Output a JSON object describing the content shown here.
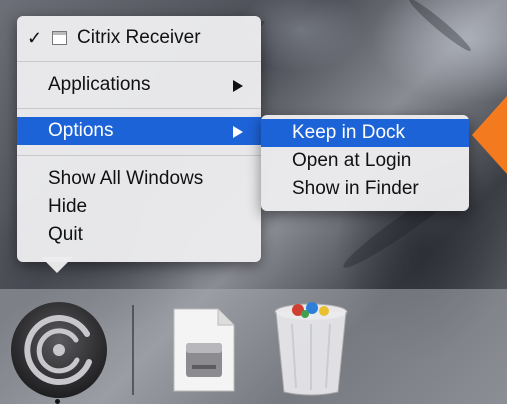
{
  "context_menu": {
    "app_name": "Citrix Receiver",
    "check_mark": "✓",
    "items": [
      {
        "label": "Applications",
        "has_submenu": true
      },
      {
        "label": "Options",
        "has_submenu": true,
        "highlighted": true
      },
      {
        "label": "Show All Windows"
      },
      {
        "label": "Hide"
      },
      {
        "label": "Quit"
      }
    ]
  },
  "options_submenu": {
    "items": [
      {
        "label": "Keep in Dock",
        "highlighted": true
      },
      {
        "label": "Open at Login"
      },
      {
        "label": "Show in Finder"
      }
    ]
  },
  "dock": {
    "apps": [
      {
        "icon": "citrix-receiver-icon",
        "running": true
      },
      {
        "icon": "disk-image-icon"
      },
      {
        "icon": "trash-icon"
      }
    ]
  },
  "colors": {
    "highlight": "#1d63d8",
    "callout_arrow": "#f47a20",
    "menu_bg": "#ececee"
  }
}
